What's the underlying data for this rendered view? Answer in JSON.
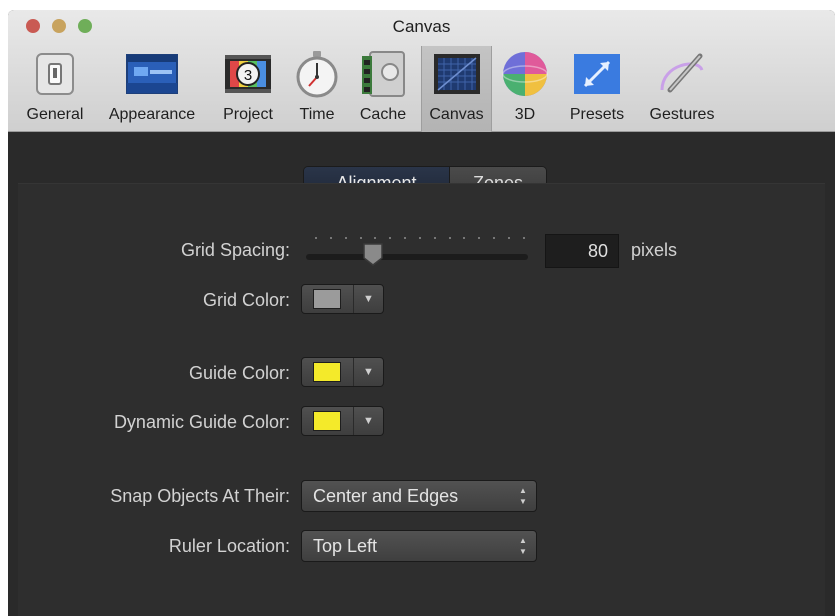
{
  "window": {
    "title": "Canvas"
  },
  "toolbar": {
    "items": [
      {
        "label": "General",
        "icon": "switch-icon"
      },
      {
        "label": "Appearance",
        "icon": "window-panel-icon"
      },
      {
        "label": "Project",
        "icon": "film-countdown-icon"
      },
      {
        "label": "Time",
        "icon": "stopwatch-icon"
      },
      {
        "label": "Cache",
        "icon": "memory-safe-icon"
      },
      {
        "label": "Canvas",
        "icon": "canvas-grid-icon"
      },
      {
        "label": "3D",
        "icon": "sphere-icon"
      },
      {
        "label": "Presets",
        "icon": "presets-arrow-icon"
      },
      {
        "label": "Gestures",
        "icon": "pen-gesture-icon"
      }
    ],
    "selected": "Canvas",
    "project_icon_number": "3"
  },
  "tabs": {
    "alignment": "Alignment",
    "zones": "Zones",
    "active": "Alignment"
  },
  "grid_spacing": {
    "label": "Grid Spacing:",
    "value": "80",
    "unit": "pixels",
    "slider_fraction": 0.28
  },
  "grid_color": {
    "label": "Grid Color:",
    "color": "#9b9b9b"
  },
  "guide_color": {
    "label": "Guide Color:",
    "color": "#f4ea2a"
  },
  "dynamic_guide_color": {
    "label": "Dynamic Guide Color:",
    "color": "#f4ea2a"
  },
  "snap_objects": {
    "label": "Snap Objects At Their:",
    "value": "Center and Edges"
  },
  "ruler_location": {
    "label": "Ruler Location:",
    "value": "Top Left"
  },
  "colors": {
    "panel_bg": "#2e2e2e",
    "accent_selected_tab": "#2a3549"
  }
}
